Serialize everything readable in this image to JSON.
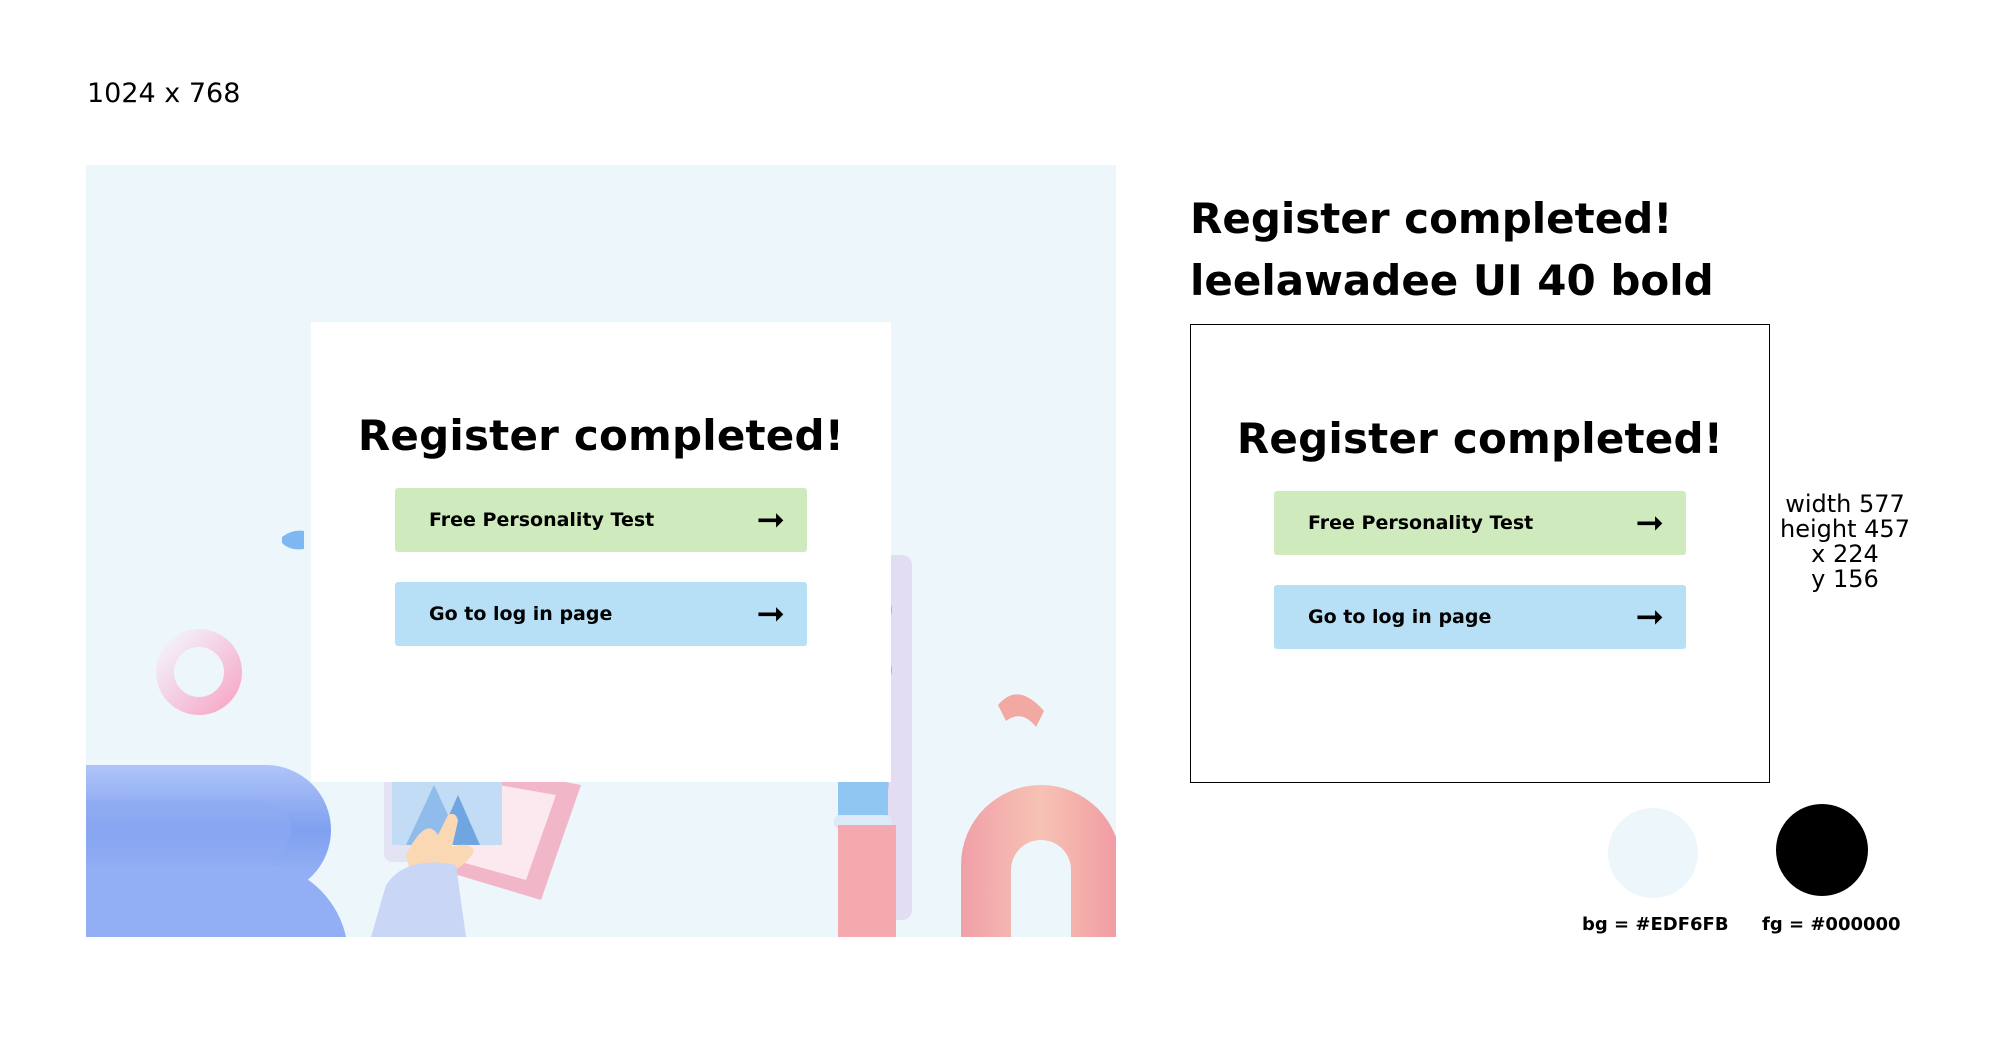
{
  "canvas_size_label": "1024 x 768",
  "mockup": {
    "title": "Register completed!",
    "buttons": [
      {
        "label": "Free Personality Test",
        "arrow": "➞",
        "color": "#CFEBBD"
      },
      {
        "label": "Go to log in page",
        "arrow": "➞",
        "color": "#B7E0F7"
      }
    ]
  },
  "spec": {
    "title_line1": "Register completed!",
    "title_line2": "leelawadee UI 40 bold",
    "box": {
      "title": "Register completed!",
      "buttons": [
        {
          "label": "Free Personality Test",
          "arrow": "➞"
        },
        {
          "label": "Go to log in page",
          "arrow": "➞"
        }
      ]
    },
    "meta": {
      "width": "width 577",
      "height": "height 457",
      "x": "x 224",
      "y": "y 156"
    }
  },
  "swatches": [
    {
      "label": "bg = #EDF6FB",
      "color": "#EDF6FB"
    },
    {
      "label": "fg = #000000",
      "color": "#000000"
    }
  ]
}
